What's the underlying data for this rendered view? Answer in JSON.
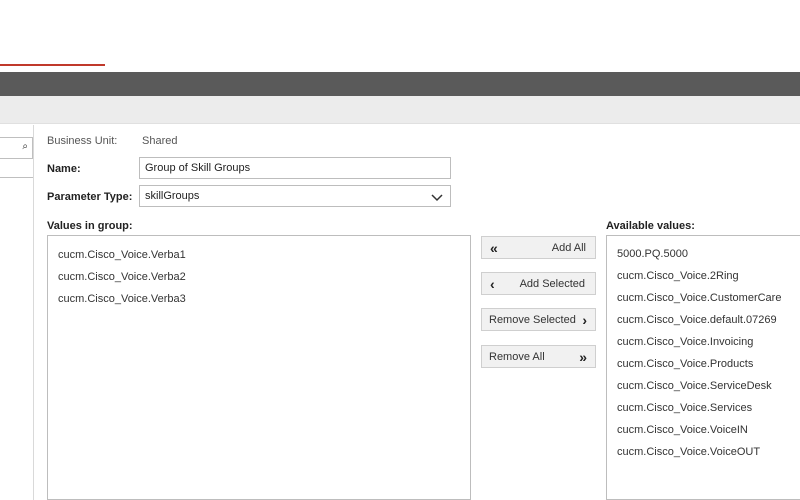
{
  "form": {
    "business_unit_label": "Business Unit:",
    "business_unit_value": "Shared",
    "name_label": "Name:",
    "name_value": "Group of Skill Groups",
    "parameter_type_label": "Parameter Type:",
    "parameter_type_value": "skillGroups",
    "values_in_group_label": "Values in group:",
    "available_values_label": "Available values:"
  },
  "group_values": [
    "cucm.Cisco_Voice.Verba1",
    "cucm.Cisco_Voice.Verba2",
    "cucm.Cisco_Voice.Verba3"
  ],
  "available_values": [
    "5000.PQ.5000",
    "cucm.Cisco_Voice.2Ring",
    "cucm.Cisco_Voice.CustomerCare",
    "cucm.Cisco_Voice.default.07269",
    "cucm.Cisco_Voice.Invoicing",
    "cucm.Cisco_Voice.Products",
    "cucm.Cisco_Voice.ServiceDesk",
    "cucm.Cisco_Voice.Services",
    "cucm.Cisco_Voice.VoiceIN",
    "cucm.Cisco_Voice.VoiceOUT"
  ],
  "buttons": {
    "add_all": {
      "label": "Add All",
      "icon": "double-chevron-left-icon"
    },
    "add_selected": {
      "label": "Add Selected",
      "icon": "chevron-left-icon"
    },
    "remove_selected": {
      "label": "Remove Selected",
      "icon": "chevron-right-icon"
    },
    "remove_all": {
      "label": "Remove All",
      "icon": "double-chevron-right-icon"
    }
  },
  "colors": {
    "accent_rule": "#c0392b",
    "header_bar": "#5a5a5a",
    "toolbar_bar": "#ececec"
  }
}
